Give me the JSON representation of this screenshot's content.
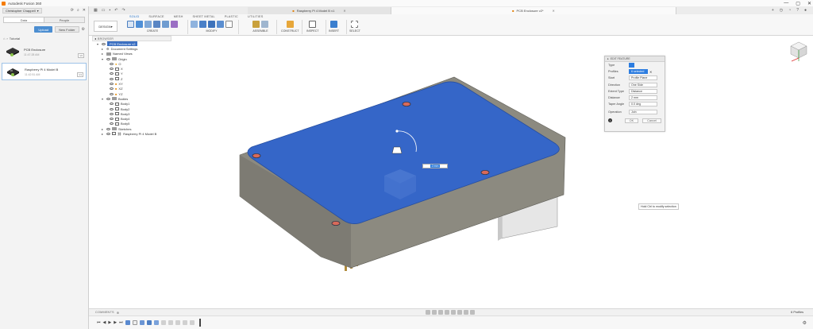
{
  "app": {
    "title": "Autodesk Fusion 360"
  },
  "window_controls": [
    "—",
    "▢",
    "✕"
  ],
  "data_panel": {
    "user": "Christopher Chappell",
    "tabs": [
      "Data",
      "People"
    ],
    "upload_label": "Upload",
    "new_folder_label": "New Folder",
    "breadcrumb": "Tutorial",
    "items": [
      {
        "name": "PCB Enclosure",
        "date": "11:47:28 AM",
        "version": "V2"
      },
      {
        "name": "Raspberry Pi 4 Model B",
        "date": "11:42:51 AM",
        "version": "V1"
      }
    ]
  },
  "tabs": [
    {
      "label": "Raspberry Pi 4 Model B v1"
    },
    {
      "label": "PCB Enclosure v2*"
    }
  ],
  "toolbar": {
    "design_label": "DESIGN",
    "workspace_tabs": [
      "SOLID",
      "SURFACE",
      "MESH",
      "SHEET METAL",
      "PLASTIC",
      "UTILITIES"
    ],
    "active_tab": "SOLID",
    "groups": [
      "CREATE",
      "MODIFY",
      "ASSEMBLE",
      "CONSTRUCT",
      "INSPECT",
      "INSERT",
      "SELECT"
    ]
  },
  "browser": {
    "title": "BROWSER",
    "root": "PCB Enclosure v2",
    "items": [
      {
        "label": "Document Settings",
        "level": 1,
        "icon": "gear"
      },
      {
        "label": "Named Views",
        "level": 1,
        "icon": "folder"
      },
      {
        "label": "Origin",
        "level": 1,
        "icon": "folder"
      },
      {
        "label": "O",
        "level": 2,
        "icon": "origin"
      },
      {
        "label": "X",
        "level": 2,
        "icon": "plane"
      },
      {
        "label": "Y",
        "level": 2,
        "icon": "plane"
      },
      {
        "label": "Z",
        "level": 2,
        "icon": "plane"
      },
      {
        "label": "XY",
        "level": 2,
        "icon": "plane"
      },
      {
        "label": "XZ",
        "level": 2,
        "icon": "plane"
      },
      {
        "label": "YZ",
        "level": 2,
        "icon": "plane"
      },
      {
        "label": "Bodies",
        "level": 1,
        "icon": "folder"
      },
      {
        "label": "Body1",
        "level": 2,
        "icon": "body"
      },
      {
        "label": "Body2",
        "level": 2,
        "icon": "body"
      },
      {
        "label": "Body3",
        "level": 2,
        "icon": "body"
      },
      {
        "label": "Body4",
        "level": 2,
        "icon": "body"
      },
      {
        "label": "Body5",
        "level": 2,
        "icon": "body"
      },
      {
        "label": "Sketches",
        "level": 1,
        "icon": "folder"
      },
      {
        "label": "Raspberry Pi 4 Model B",
        "level": 1,
        "icon": "link"
      }
    ]
  },
  "edit_feature": {
    "title": "EDIT FEATURE",
    "rows": [
      {
        "label": "Type",
        "value": ""
      },
      {
        "label": "Profiles",
        "value": "6 selected"
      },
      {
        "label": "Start",
        "value": "Profile Plane"
      },
      {
        "label": "Direction",
        "value": "One Side"
      },
      {
        "label": "Extent Type",
        "value": "Distance"
      },
      {
        "label": "Distance",
        "value": "2 mm"
      },
      {
        "label": "Taper Angle",
        "value": "0.0 deg"
      },
      {
        "label": "Operation",
        "value": "Join"
      }
    ],
    "ok_label": "OK",
    "cancel_label": "Cancel"
  },
  "tooltip": "Hold Ctrl to modify selection",
  "dimension_input": "2 mm",
  "comments_label": "COMMENTS",
  "status_text": "6 Profiles",
  "colors": {
    "accent": "#2d7de0",
    "body_blue": "#3566c8",
    "body_gray": "#8c8a80"
  }
}
